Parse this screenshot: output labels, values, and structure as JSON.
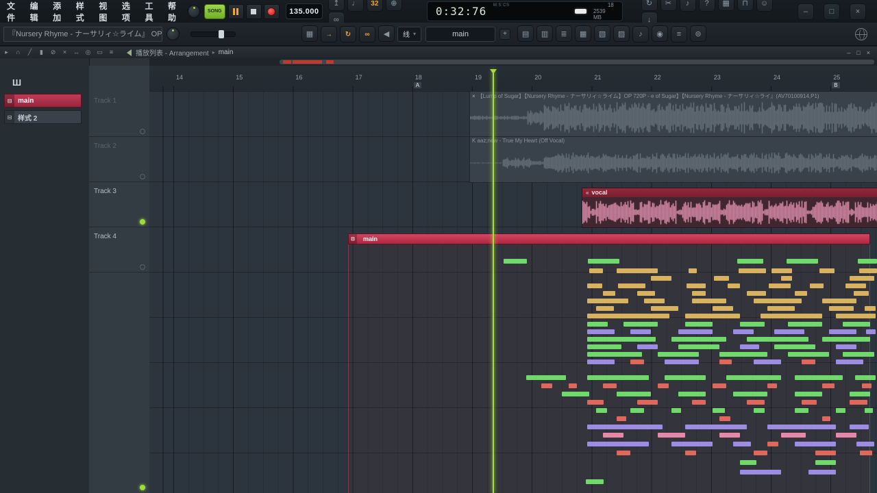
{
  "colors": {
    "accent_orange": "#f5a52c",
    "song_green": "#8ad23c",
    "record_red": "#d92b25",
    "playhead_green": "#aadd3c",
    "pattern_red": "#c22e4a",
    "vocal_header": "#8c2133",
    "vocal_wave": "#f3a9c5",
    "audio_wave": "#6e7983",
    "note_green": "#6fd96a",
    "note_orange": "#d8b25e",
    "note_purple": "#9c8ce4",
    "note_red": "#e0685a",
    "note_pink": "#e888a8"
  },
  "menu": {
    "items": [
      "文件",
      "编辑",
      "添加",
      "样式",
      "视图",
      "选项",
      "工具",
      "帮助"
    ]
  },
  "transport": {
    "mode_label": "SONG",
    "tempo": "135.000",
    "time": "0:32:76",
    "time_unit": "M:S:CS"
  },
  "status": {
    "level": "18",
    "memory": "2539 MB"
  },
  "titlebar_icons_mid": [
    {
      "name": "wait-for-input-icon",
      "glyph": "↥"
    },
    {
      "name": "metronome-icon",
      "glyph": "♩"
    },
    {
      "name": "typing-keyboard-icon",
      "glyph": "32",
      "cls": "org"
    },
    {
      "name": "blend-notes-icon",
      "glyph": "⊕"
    },
    {
      "name": "multilink-icon",
      "glyph": "∞"
    }
  ],
  "titlebar_icons_right": [
    {
      "name": "sync-icon",
      "glyph": "↻"
    },
    {
      "name": "cut-icon",
      "glyph": "✂"
    },
    {
      "name": "mic-icon",
      "glyph": "♪"
    },
    {
      "name": "help-icon",
      "glyph": "?"
    },
    {
      "name": "save-icon",
      "glyph": "▦"
    },
    {
      "name": "plugin-icon",
      "glyph": "⊓"
    },
    {
      "name": "feedback-icon",
      "glyph": "☺"
    },
    {
      "name": "download-icon",
      "glyph": "↓"
    }
  ],
  "app_window_controls": [
    {
      "name": "minimize-button",
      "glyph": "–"
    },
    {
      "name": "maximize-button",
      "glyph": "□"
    },
    {
      "name": "close-button",
      "glyph": "×"
    }
  ],
  "toolbar2": {
    "song_title": "『Nursery Rhyme - ナーサリィ☆ライム』 OP",
    "snap_label": "线",
    "pattern_selector": "main",
    "add_label": "+",
    "icons_a": [
      {
        "name": "record-settings-icon",
        "glyph": "▦"
      },
      {
        "name": "overdub-record-icon",
        "glyph": "→",
        "cls": "org"
      },
      {
        "name": "loop-record-icon",
        "glyph": "↻",
        "cls": "org"
      },
      {
        "name": "link-icon",
        "glyph": "∞",
        "cls": "org"
      },
      {
        "name": "monitor-icon",
        "glyph": "◀"
      }
    ],
    "icons_b": [
      {
        "name": "playlist-icon",
        "glyph": "▤"
      },
      {
        "name": "piano-roll-icon",
        "glyph": "▥"
      },
      {
        "name": "channel-rack-icon",
        "glyph": "≣"
      },
      {
        "name": "mixer-icon",
        "glyph": "▦"
      },
      {
        "name": "browser-icon",
        "glyph": "▧"
      },
      {
        "name": "project-picker-icon",
        "glyph": "▨"
      },
      {
        "name": "plugin-picker-icon",
        "glyph": "♪"
      },
      {
        "name": "touch-controller-icon",
        "glyph": "◉"
      },
      {
        "name": "script-output-icon",
        "glyph": "≡"
      },
      {
        "name": "remote-icon",
        "glyph": "⊚"
      }
    ]
  },
  "playlist": {
    "title": "播放列表 - Arrangement",
    "breadcrumb_sep": "▸",
    "current": "main",
    "tool_icons": [
      {
        "name": "pointer-tool-icon",
        "glyph": "▸"
      },
      {
        "name": "magnet-icon",
        "glyph": "∩"
      },
      {
        "name": "pencil-tool-icon",
        "glyph": "╱"
      },
      {
        "name": "brush-tool-icon",
        "glyph": "▮"
      },
      {
        "name": "delete-tool-icon",
        "glyph": "⊘"
      },
      {
        "name": "mute-tool-icon",
        "glyph": "×"
      },
      {
        "name": "slip-tool-icon",
        "glyph": "↔"
      },
      {
        "name": "zoom-tool-icon",
        "glyph": "◎"
      },
      {
        "name": "select-tool-icon",
        "glyph": "▭"
      },
      {
        "name": "menu-icon",
        "glyph": "≡"
      }
    ],
    "window_controls": [
      {
        "name": "pl-minimize-button",
        "glyph": "–"
      },
      {
        "name": "pl-maximize-button",
        "glyph": "□"
      },
      {
        "name": "pl-close-button",
        "glyph": "×"
      }
    ],
    "corner": {
      "add_label": "+",
      "mini_icons": [
        {
          "name": "grid-size-icon",
          "glyph": "▦"
        },
        {
          "name": "draw-mode-icon",
          "glyph": "╱"
        },
        {
          "name": "more-icon",
          "glyph": "▾"
        }
      ]
    },
    "picker_icon": "Ш",
    "patterns": [
      {
        "label": "main",
        "selected": true
      },
      {
        "label": "样式 2",
        "selected": false
      }
    ],
    "tracks": [
      {
        "name": "Track 1",
        "dim": true,
        "armed": false
      },
      {
        "name": "Track 2",
        "dim": true,
        "armed": false
      },
      {
        "name": "Track 3",
        "dim": false,
        "armed": true
      },
      {
        "name": "Track 4",
        "dim": false,
        "armed": false
      }
    ],
    "ruler": {
      "ticks": [
        14,
        15,
        16,
        17,
        18,
        19,
        20,
        21,
        22,
        23,
        24,
        25
      ],
      "markers": [
        {
          "label": "A",
          "bar": 18
        },
        {
          "label": "B",
          "bar": 25
        }
      ]
    }
  },
  "clips": {
    "audio1": {
      "mute_icon": "×",
      "label": "【Lump of Sugar】【Nursery Rhyme - ナーサリィ☆ライム】OP 720P - e of Sugar】【Nursery Rhyme - ナーサリィ☆ライ』(AV70100914,P1)"
    },
    "audio2": {
      "label": "K aaz;new - True My Heart (Off Vocal)"
    },
    "vocal": {
      "icon": "«",
      "label": "vocal"
    },
    "main": {
      "icon": "⊟",
      "label": "main"
    }
  },
  "notes": [
    [
      517,
      282,
      34,
      "g"
    ],
    [
      640,
      282,
      46,
      "g"
    ],
    [
      858,
      282,
      38,
      "g"
    ],
    [
      930,
      282,
      46,
      "g"
    ],
    [
      1034,
      282,
      28,
      "g"
    ],
    [
      642,
      296,
      20,
      "o"
    ],
    [
      682,
      296,
      60,
      "o"
    ],
    [
      787,
      296,
      12,
      "o"
    ],
    [
      860,
      296,
      40,
      "o"
    ],
    [
      908,
      296,
      30,
      "o"
    ],
    [
      978,
      296,
      22,
      "o"
    ],
    [
      1036,
      296,
      26,
      "o"
    ],
    [
      732,
      307,
      30,
      "o"
    ],
    [
      824,
      307,
      22,
      "o"
    ],
    [
      922,
      307,
      16,
      "o"
    ],
    [
      1022,
      307,
      36,
      "o"
    ],
    [
      639,
      318,
      22,
      "o"
    ],
    [
      684,
      318,
      40,
      "o"
    ],
    [
      784,
      318,
      28,
      "o"
    ],
    [
      844,
      318,
      18,
      "o"
    ],
    [
      904,
      318,
      32,
      "o"
    ],
    [
      964,
      318,
      20,
      "o"
    ],
    [
      1016,
      318,
      30,
      "o"
    ],
    [
      662,
      329,
      18,
      "o"
    ],
    [
      712,
      329,
      26,
      "o"
    ],
    [
      792,
      329,
      20,
      "o"
    ],
    [
      872,
      329,
      28,
      "o"
    ],
    [
      942,
      329,
      18,
      "o"
    ],
    [
      1028,
      329,
      22,
      "o"
    ],
    [
      639,
      340,
      60,
      "o"
    ],
    [
      722,
      340,
      30,
      "o"
    ],
    [
      792,
      340,
      50,
      "o"
    ],
    [
      882,
      340,
      70,
      "o"
    ],
    [
      982,
      340,
      50,
      "o"
    ],
    [
      652,
      351,
      26,
      "o"
    ],
    [
      732,
      351,
      40,
      "o"
    ],
    [
      822,
      351,
      30,
      "o"
    ],
    [
      902,
      351,
      40,
      "o"
    ],
    [
      992,
      351,
      36,
      "o"
    ],
    [
      1044,
      351,
      16,
      "o"
    ],
    [
      639,
      362,
      120,
      "o"
    ],
    [
      782,
      362,
      80,
      "o"
    ],
    [
      892,
      362,
      90,
      "o"
    ],
    [
      1002,
      362,
      58,
      "o"
    ],
    [
      639,
      374,
      30,
      "g"
    ],
    [
      692,
      374,
      50,
      "g"
    ],
    [
      782,
      374,
      40,
      "g"
    ],
    [
      862,
      374,
      36,
      "g"
    ],
    [
      932,
      374,
      50,
      "g"
    ],
    [
      1012,
      374,
      40,
      "g"
    ],
    [
      639,
      385,
      40,
      "p"
    ],
    [
      702,
      385,
      30,
      "p"
    ],
    [
      772,
      385,
      50,
      "p"
    ],
    [
      852,
      385,
      30,
      "p"
    ],
    [
      912,
      385,
      44,
      "p"
    ],
    [
      992,
      385,
      40,
      "p"
    ],
    [
      1046,
      385,
      14,
      "p"
    ],
    [
      639,
      396,
      100,
      "g"
    ],
    [
      762,
      396,
      80,
      "g"
    ],
    [
      872,
      396,
      90,
      "g"
    ],
    [
      982,
      396,
      70,
      "g"
    ],
    [
      639,
      407,
      50,
      "g"
    ],
    [
      712,
      407,
      30,
      "p"
    ],
    [
      772,
      407,
      60,
      "g"
    ],
    [
      862,
      407,
      28,
      "p"
    ],
    [
      912,
      407,
      60,
      "g"
    ],
    [
      1002,
      407,
      30,
      "p"
    ],
    [
      639,
      418,
      80,
      "g"
    ],
    [
      742,
      418,
      60,
      "g"
    ],
    [
      832,
      418,
      70,
      "g"
    ],
    [
      932,
      418,
      60,
      "g"
    ],
    [
      1012,
      418,
      46,
      "g"
    ],
    [
      639,
      429,
      40,
      "p"
    ],
    [
      702,
      429,
      20,
      "r"
    ],
    [
      752,
      429,
      50,
      "p"
    ],
    [
      832,
      429,
      18,
      "r"
    ],
    [
      882,
      429,
      40,
      "p"
    ],
    [
      952,
      429,
      20,
      "r"
    ],
    [
      1002,
      429,
      40,
      "p"
    ],
    [
      550,
      452,
      58,
      "g"
    ],
    [
      639,
      452,
      90,
      "g"
    ],
    [
      752,
      452,
      60,
      "g"
    ],
    [
      842,
      452,
      80,
      "g"
    ],
    [
      942,
      452,
      70,
      "g"
    ],
    [
      1030,
      452,
      30,
      "g"
    ],
    [
      572,
      464,
      16,
      "r"
    ],
    [
      612,
      464,
      12,
      "r"
    ],
    [
      662,
      464,
      20,
      "r"
    ],
    [
      742,
      464,
      16,
      "r"
    ],
    [
      822,
      464,
      20,
      "r"
    ],
    [
      902,
      464,
      14,
      "r"
    ],
    [
      982,
      464,
      18,
      "r"
    ],
    [
      1040,
      464,
      14,
      "r"
    ],
    [
      602,
      476,
      40,
      "g"
    ],
    [
      682,
      476,
      50,
      "g"
    ],
    [
      772,
      476,
      40,
      "g"
    ],
    [
      852,
      476,
      50,
      "g"
    ],
    [
      942,
      476,
      40,
      "g"
    ],
    [
      1022,
      476,
      30,
      "g"
    ],
    [
      639,
      488,
      24,
      "r"
    ],
    [
      712,
      488,
      30,
      "r"
    ],
    [
      792,
      488,
      20,
      "r"
    ],
    [
      872,
      488,
      26,
      "r"
    ],
    [
      952,
      488,
      22,
      "r"
    ],
    [
      1022,
      488,
      26,
      "r"
    ],
    [
      652,
      500,
      16,
      "g"
    ],
    [
      702,
      500,
      20,
      "g"
    ],
    [
      762,
      500,
      14,
      "g"
    ],
    [
      822,
      500,
      18,
      "g"
    ],
    [
      882,
      500,
      16,
      "g"
    ],
    [
      942,
      500,
      20,
      "g"
    ],
    [
      1002,
      500,
      14,
      "g"
    ],
    [
      1044,
      500,
      12,
      "g"
    ],
    [
      682,
      512,
      14,
      "r"
    ],
    [
      832,
      512,
      16,
      "r"
    ],
    [
      982,
      512,
      12,
      "r"
    ],
    [
      639,
      524,
      110,
      "p"
    ],
    [
      782,
      524,
      90,
      "p"
    ],
    [
      902,
      524,
      100,
      "p"
    ],
    [
      1022,
      524,
      28,
      "p"
    ],
    [
      662,
      536,
      30,
      "k"
    ],
    [
      742,
      536,
      40,
      "k"
    ],
    [
      832,
      536,
      30,
      "k"
    ],
    [
      922,
      536,
      36,
      "k"
    ],
    [
      1002,
      536,
      30,
      "k"
    ],
    [
      639,
      549,
      90,
      "p"
    ],
    [
      762,
      549,
      60,
      "p"
    ],
    [
      852,
      549,
      26,
      "p"
    ],
    [
      902,
      549,
      16,
      "r"
    ],
    [
      942,
      549,
      60,
      "p"
    ],
    [
      1032,
      549,
      26,
      "p"
    ],
    [
      682,
      562,
      20,
      "r"
    ],
    [
      782,
      562,
      16,
      "r"
    ],
    [
      882,
      562,
      20,
      "r"
    ],
    [
      972,
      562,
      30,
      "r"
    ],
    [
      1037,
      562,
      18,
      "r"
    ],
    [
      862,
      576,
      24,
      "g"
    ],
    [
      972,
      576,
      30,
      "g"
    ],
    [
      862,
      590,
      60,
      "p"
    ],
    [
      962,
      590,
      40,
      "p"
    ],
    [
      637,
      604,
      26,
      "g"
    ]
  ]
}
